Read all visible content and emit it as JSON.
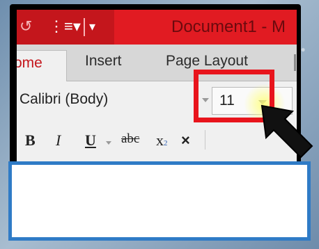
{
  "quick_access": {
    "undo_icon": "undo-icon",
    "list_icon": "numbered-list-icon",
    "customize_icon": "customize-quick-access-icon"
  },
  "window": {
    "title": "Document1 - M"
  },
  "ribbon": {
    "tabs": [
      {
        "label": "ome",
        "active": true
      },
      {
        "label": "Insert",
        "active": false
      },
      {
        "label": "Page Layout",
        "active": false
      }
    ],
    "font": {
      "name": "Calibri (Body)",
      "size": "11"
    },
    "format_buttons": {
      "bold": "B",
      "italic": "I",
      "underline": "U",
      "strikethrough": "abc",
      "subscript_base": "x",
      "subscript_mark": "2",
      "clear": "×"
    }
  },
  "colors": {
    "title_bar": "#e11b22",
    "highlight": "#e8141c",
    "caption_border": "#2f7bc6"
  }
}
